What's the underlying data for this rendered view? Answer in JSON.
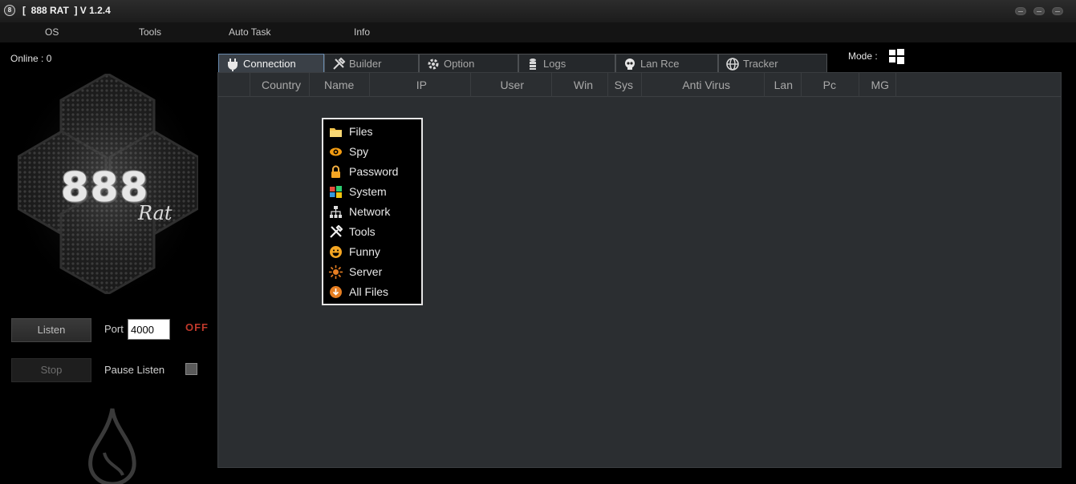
{
  "window": {
    "title": "[  888 RAT  ] V 1.2.4",
    "icon_glyph": "8"
  },
  "menu": {
    "items": [
      "OS",
      "Tools",
      "Auto Task",
      "Info"
    ]
  },
  "left_panel": {
    "online_label": "Online : 0",
    "logo_text": "888",
    "logo_subtext": "Rat",
    "listen_label": "Listen",
    "stop_label": "Stop",
    "port_label": "Port",
    "port_value": "4000",
    "status_text": "OFF",
    "pause_label": "Pause Listen",
    "pause_checked": false
  },
  "tabs": [
    {
      "label": "Connection",
      "icon": "plug-icon",
      "active": true
    },
    {
      "label": "Builder",
      "icon": "tools-icon",
      "active": false
    },
    {
      "label": "Option",
      "icon": "gear-icon",
      "active": false
    },
    {
      "label": "Logs",
      "icon": "database-icon",
      "active": false
    },
    {
      "label": "Lan Rce",
      "icon": "skull-icon",
      "active": false
    },
    {
      "label": "Tracker",
      "icon": "globe-icon",
      "active": false
    }
  ],
  "mode": {
    "label": "Mode :",
    "icon": "windows-icon"
  },
  "table": {
    "columns": [
      "Country",
      "Name",
      "IP",
      "User",
      "Win",
      "Sys",
      "Anti Virus",
      "Lan",
      "Pc",
      "MG"
    ],
    "rows": []
  },
  "context_menu": {
    "items": [
      {
        "label": "Files",
        "icon": "folder-icon"
      },
      {
        "label": "Spy",
        "icon": "eye-icon"
      },
      {
        "label": "Password",
        "icon": "lock-icon"
      },
      {
        "label": "System",
        "icon": "windows-icon"
      },
      {
        "label": "Network",
        "icon": "network-icon"
      },
      {
        "label": "Tools",
        "icon": "tools-icon"
      },
      {
        "label": "Funny",
        "icon": "smiley-icon"
      },
      {
        "label": "Server",
        "icon": "sun-icon"
      },
      {
        "label": "All Files",
        "icon": "download-icon"
      }
    ]
  },
  "colors": {
    "status_off": "#c0392b",
    "active_tab_border": "#6a8cb0",
    "panel_bg": "#2b2e31"
  }
}
